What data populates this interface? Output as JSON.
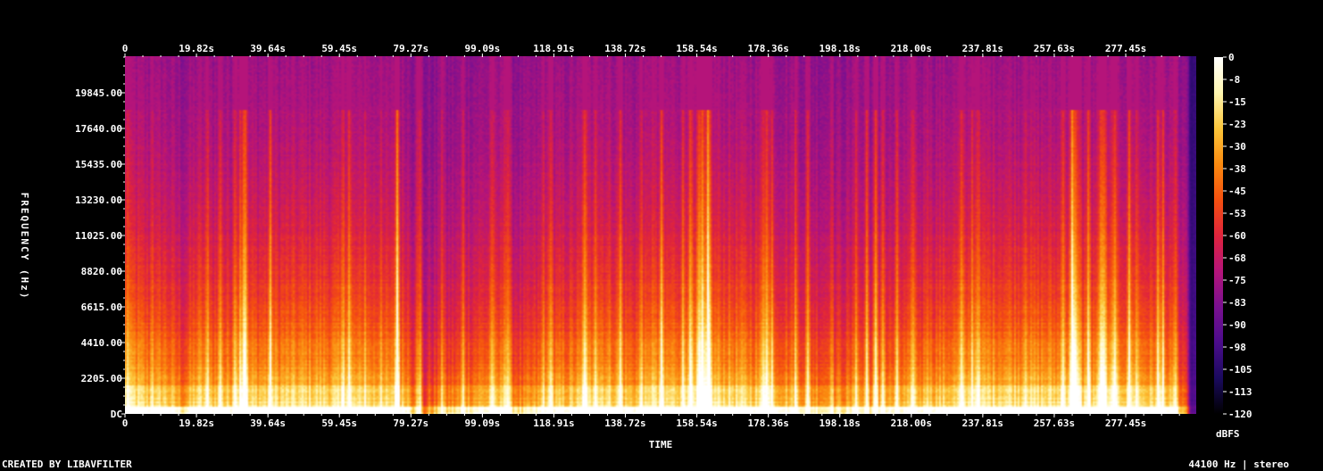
{
  "chart_data": {
    "type": "heatmap",
    "title": "",
    "xlabel": "TIME",
    "ylabel": "FREQUENCY (Hz)",
    "x_ticks": [
      "0",
      "19.82s",
      "39.64s",
      "59.45s",
      "79.27s",
      "99.09s",
      "118.91s",
      "138.72s",
      "158.54s",
      "178.36s",
      "198.18s",
      "218.00s",
      "237.81s",
      "257.63s",
      "277.45s"
    ],
    "x_tick_values": [
      0,
      19.82,
      39.64,
      59.45,
      79.27,
      99.09,
      118.91,
      138.72,
      158.54,
      178.36,
      198.18,
      218.0,
      237.81,
      257.63,
      277.45
    ],
    "xlim": [
      0,
      297
    ],
    "y_ticks": [
      "DC",
      "2205.00",
      "4410.00",
      "6615.00",
      "8820.00",
      "11025.00",
      "13230.00",
      "15435.00",
      "17640.00",
      "19845.00"
    ],
    "y_tick_values": [
      0,
      2205,
      4410,
      6615,
      8820,
      11025,
      13230,
      15435,
      17640,
      19845
    ],
    "ylim": [
      0,
      22050
    ],
    "colorbar": {
      "label": "dBFS",
      "ticks": [
        "0",
        "-8",
        "-15",
        "-23",
        "-30",
        "-38",
        "-45",
        "-53",
        "-60",
        "-68",
        "-75",
        "-83",
        "-90",
        "-98",
        "-105",
        "-113",
        "-120"
      ],
      "range": [
        -120,
        0
      ]
    },
    "colormap": [
      "#000000",
      "#1a0a5e",
      "#4b0c8c",
      "#7a1090",
      "#b5147a",
      "#e0243c",
      "#f5500f",
      "#fb8a0f",
      "#fcc63a",
      "#fff6b0",
      "#ffffff"
    ],
    "energy_profile": [
      {
        "t": 0,
        "e": 0.7
      },
      {
        "t": 2,
        "e": 0.85
      },
      {
        "t": 8,
        "e": 0.7
      },
      {
        "t": 10,
        "e": 0.8
      },
      {
        "t": 16,
        "e": 0.6
      },
      {
        "t": 20,
        "e": 0.82
      },
      {
        "t": 26,
        "e": 0.72
      },
      {
        "t": 34,
        "e": 0.78
      },
      {
        "t": 42,
        "e": 0.8
      },
      {
        "t": 52,
        "e": 0.82
      },
      {
        "t": 62,
        "e": 0.8
      },
      {
        "t": 70,
        "e": 0.76
      },
      {
        "t": 78,
        "e": 0.74
      },
      {
        "t": 82,
        "e": 0.3
      },
      {
        "t": 84,
        "e": 0.45
      },
      {
        "t": 90,
        "e": 0.55
      },
      {
        "t": 96,
        "e": 0.65
      },
      {
        "t": 104,
        "e": 0.72
      },
      {
        "t": 110,
        "e": 0.55
      },
      {
        "t": 116,
        "e": 0.68
      },
      {
        "t": 124,
        "e": 0.74
      },
      {
        "t": 132,
        "e": 0.85
      },
      {
        "t": 140,
        "e": 0.72
      },
      {
        "t": 150,
        "e": 0.8
      },
      {
        "t": 160,
        "e": 0.86
      },
      {
        "t": 168,
        "e": 0.82
      },
      {
        "t": 178,
        "e": 0.76
      },
      {
        "t": 186,
        "e": 0.68
      },
      {
        "t": 196,
        "e": 0.6
      },
      {
        "t": 206,
        "e": 0.62
      },
      {
        "t": 214,
        "e": 0.66
      },
      {
        "t": 222,
        "e": 0.72
      },
      {
        "t": 232,
        "e": 0.8
      },
      {
        "t": 242,
        "e": 0.84
      },
      {
        "t": 252,
        "e": 0.82
      },
      {
        "t": 262,
        "e": 0.8
      },
      {
        "t": 272,
        "e": 0.82
      },
      {
        "t": 282,
        "e": 0.78
      },
      {
        "t": 290,
        "e": 0.7
      },
      {
        "t": 294,
        "e": 0.35
      },
      {
        "t": 297,
        "e": 0.05
      }
    ]
  },
  "footer": {
    "left": "CREATED BY LIBAVFILTER",
    "right": "44100 Hz | stereo"
  }
}
